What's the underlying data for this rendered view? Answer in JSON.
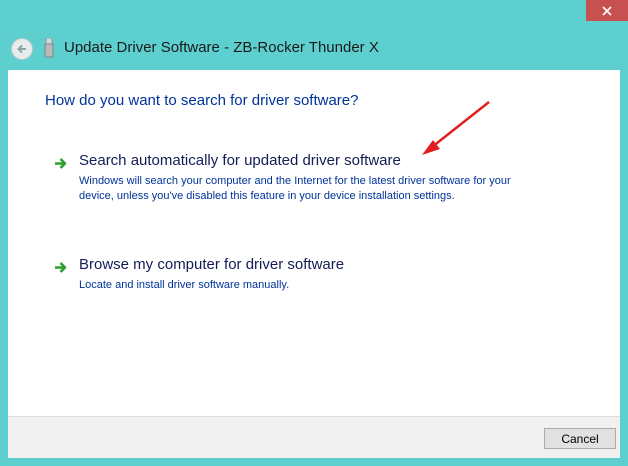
{
  "window": {
    "title": "Update Driver Software - ZB-Rocker Thunder X",
    "accent_color": "#5ecfcf",
    "close_label": "✕"
  },
  "icons": {
    "back": "back-arrow-icon",
    "device": "usb-device-icon",
    "option": "green-arrow-icon",
    "annotation": "red-annotation-arrow"
  },
  "main": {
    "heading": "How do you want to search for driver software?",
    "options": [
      {
        "title": "Search automatically for updated driver software",
        "description": "Windows will search your computer and the Internet for the latest driver software for your device, unless you've disabled this feature in your device installation settings."
      },
      {
        "title": "Browse my computer for driver software",
        "description": "Locate and install driver software manually."
      }
    ]
  },
  "footer": {
    "cancel_label": "Cancel"
  }
}
